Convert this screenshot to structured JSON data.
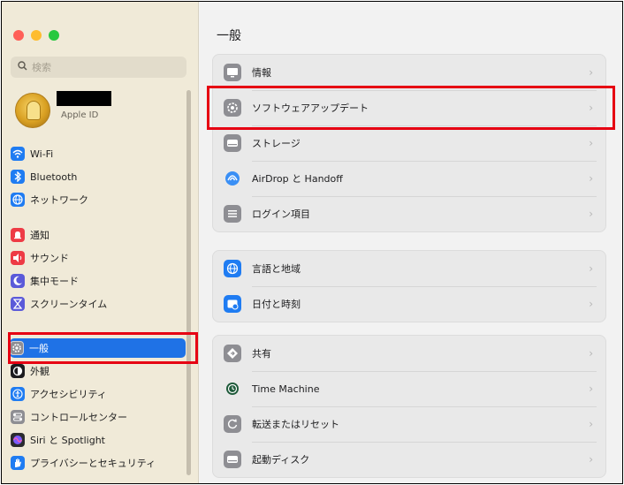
{
  "sidebar": {
    "search_placeholder": "検索",
    "account": {
      "subtitle": "Apple ID"
    },
    "items": [
      {
        "label": "Wi-Fi",
        "icon": "wifi-icon",
        "color": "#1f7cf2"
      },
      {
        "label": "Bluetooth",
        "icon": "bluetooth-icon",
        "color": "#1f7cf2"
      },
      {
        "label": "ネットワーク",
        "icon": "globe-icon",
        "color": "#1f7cf2"
      },
      {
        "label": "通知",
        "icon": "bell-icon",
        "color": "#ee3b45"
      },
      {
        "label": "サウンド",
        "icon": "speaker-icon",
        "color": "#ee3b45"
      },
      {
        "label": "集中モード",
        "icon": "moon-icon",
        "color": "#5b5ad9"
      },
      {
        "label": "スクリーンタイム",
        "icon": "hourglass-icon",
        "color": "#5b5ad9"
      },
      {
        "label": "一般",
        "icon": "gear-icon",
        "color": "#8e8e93",
        "selected": true
      },
      {
        "label": "外観",
        "icon": "appearance-icon",
        "color": "#1c1c1e"
      },
      {
        "label": "アクセシビリティ",
        "icon": "accessibility-icon",
        "color": "#1f7cf2"
      },
      {
        "label": "コントロールセンター",
        "icon": "control-center-icon",
        "color": "#8e8e93"
      },
      {
        "label": "Siri と Spotlight",
        "icon": "siri-icon",
        "color": "#2b2b2e"
      },
      {
        "label": "プライバシーとセキュリティ",
        "icon": "hand-icon",
        "color": "#1f7cf2"
      }
    ]
  },
  "main": {
    "title": "一般",
    "groups": [
      [
        {
          "label": "情報",
          "icon": "info-icon"
        },
        {
          "label": "ソフトウェアアップデート",
          "icon": "software-update-icon"
        },
        {
          "label": "ストレージ",
          "icon": "storage-icon"
        },
        {
          "label": "AirDrop と Handoff",
          "icon": "airdrop-icon"
        },
        {
          "label": "ログイン項目",
          "icon": "login-items-icon"
        }
      ],
      [
        {
          "label": "言語と地域",
          "icon": "language-globe-icon"
        },
        {
          "label": "日付と時刻",
          "icon": "date-time-icon"
        }
      ],
      [
        {
          "label": "共有",
          "icon": "sharing-icon"
        },
        {
          "label": "Time Machine",
          "icon": "time-machine-icon"
        },
        {
          "label": "転送またはリセット",
          "icon": "reset-icon"
        },
        {
          "label": "起動ディスク",
          "icon": "startup-disk-icon"
        }
      ]
    ],
    "chevron": "›"
  },
  "colors": {
    "highlight": "#e60012",
    "selection": "#1f72e6",
    "sidebar_bg": "#f0ead8"
  }
}
